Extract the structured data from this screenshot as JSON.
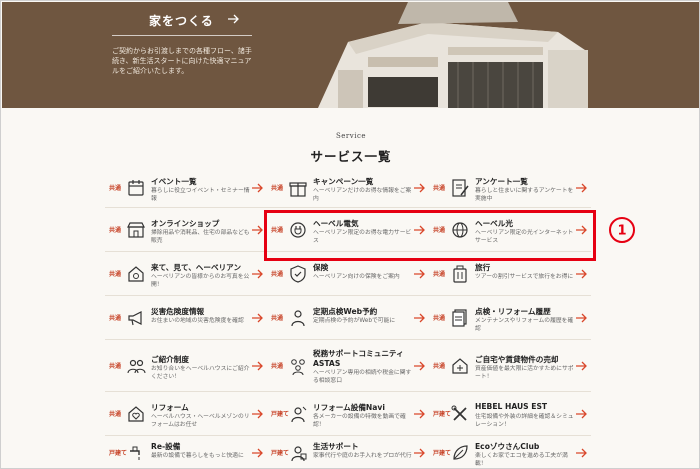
{
  "hero": {
    "button_label": "家をつくる",
    "description": "ご契約からお引渡しまでの各種フロー、諸手続き、新生活スタートに向けた快適マニュアルをご紹介いたします。"
  },
  "section": {
    "subtitle": "Service",
    "title": "サービス一覧"
  },
  "services": [
    {
      "tag": "共通",
      "title": "イベント一覧",
      "desc": "暮らしに役立つイベント・セミナー情報",
      "icon": "calendar-icon"
    },
    {
      "tag": "共通",
      "title": "キャンペーン一覧",
      "desc": "ヘーベリアンだけのお得な情報をご案内",
      "icon": "gift-icon"
    },
    {
      "tag": "共通",
      "title": "アンケート一覧",
      "desc": "暮らしと住まいに関するアンケートを実施中",
      "icon": "pencil-note-icon"
    },
    {
      "tag": "共通",
      "title": "オンラインショップ",
      "desc": "掃除用品や消耗品、住宅の部品なども販売",
      "icon": "shop-icon"
    },
    {
      "tag": "共通",
      "title": "ヘーベル電気",
      "desc": "ヘーベリアン限定のお得な電力サービス",
      "icon": "plug-icon"
    },
    {
      "tag": "共通",
      "title": "ヘーベル光",
      "desc": "ヘーベリアン限定の光インターネットサービス",
      "icon": "globe-icon"
    },
    {
      "tag": "共通",
      "title": "来て、見て、ヘーベリアン",
      "desc": "ヘーベリアンの皆様からのお写真を公開！",
      "icon": "camera-house-icon"
    },
    {
      "tag": "共通",
      "title": "保険",
      "desc": "ヘーベリアン向けの保険をご案内",
      "icon": "shield-icon"
    },
    {
      "tag": "共通",
      "title": "旅行",
      "desc": "ツアーの割引サービスで旅行をお得に",
      "icon": "suitcase-icon"
    },
    {
      "tag": "共通",
      "title": "災害危険度情報",
      "desc": "お住まいの地域の災害危険度を確認",
      "icon": "megaphone-icon"
    },
    {
      "tag": "共通",
      "title": "定期点検Web予約",
      "desc": "定期点検の予約がWebで可能に",
      "icon": "inspector-icon"
    },
    {
      "tag": "共通",
      "title": "点検・リフォーム履歴",
      "desc": "メンテナンスやリフォームの履歴を確認",
      "icon": "document-stack-icon"
    },
    {
      "tag": "共通",
      "title": "ご紹介制度",
      "desc": "お知り合いをヘーベルハウスにご紹介ください！",
      "icon": "people-icon"
    },
    {
      "tag": "共通",
      "title": "税務サポートコミュニティASTAS",
      "desc": "ヘーベリアン専用の相続や税金に関する相談窓口",
      "icon": "tax-group-icon"
    },
    {
      "tag": "共通",
      "title": "ご自宅や賃貸物件の売却",
      "desc": "資産価値を最大限に活かすためにサポート！",
      "icon": "house-sale-icon"
    },
    {
      "tag": "共通",
      "title": "リフォーム",
      "desc": "ヘーベルハウス・ヘーベルメゾンのリフォームはお任せ",
      "icon": "house-heart-icon"
    },
    {
      "tag": "戸建て",
      "title": "リフォーム設備Navi",
      "desc": "各メーカーの設備の特徴を動画で確認！",
      "icon": "tools-icon"
    },
    {
      "tag": "戸建て",
      "title": "HEBEL HAUS EST",
      "desc": "住宅設備や外装の詳細を確認＆シミュレーション！",
      "icon": "wrench-cross-icon"
    },
    {
      "tag": "戸建て",
      "title": "Re-設備",
      "desc": "最新の設備で暮らしをもっと快適に",
      "icon": "faucet-icon"
    },
    {
      "tag": "戸建て",
      "title": "生活サポート",
      "desc": "家事代行や庭のお手入れをプロが代行",
      "icon": "support-icon"
    },
    {
      "tag": "戸建て",
      "title": "EcoゾウさんClub",
      "desc": "楽しくお家でエコを進める工夫が満載！",
      "icon": "leaf-icon"
    }
  ],
  "annotation": {
    "number": "①"
  }
}
